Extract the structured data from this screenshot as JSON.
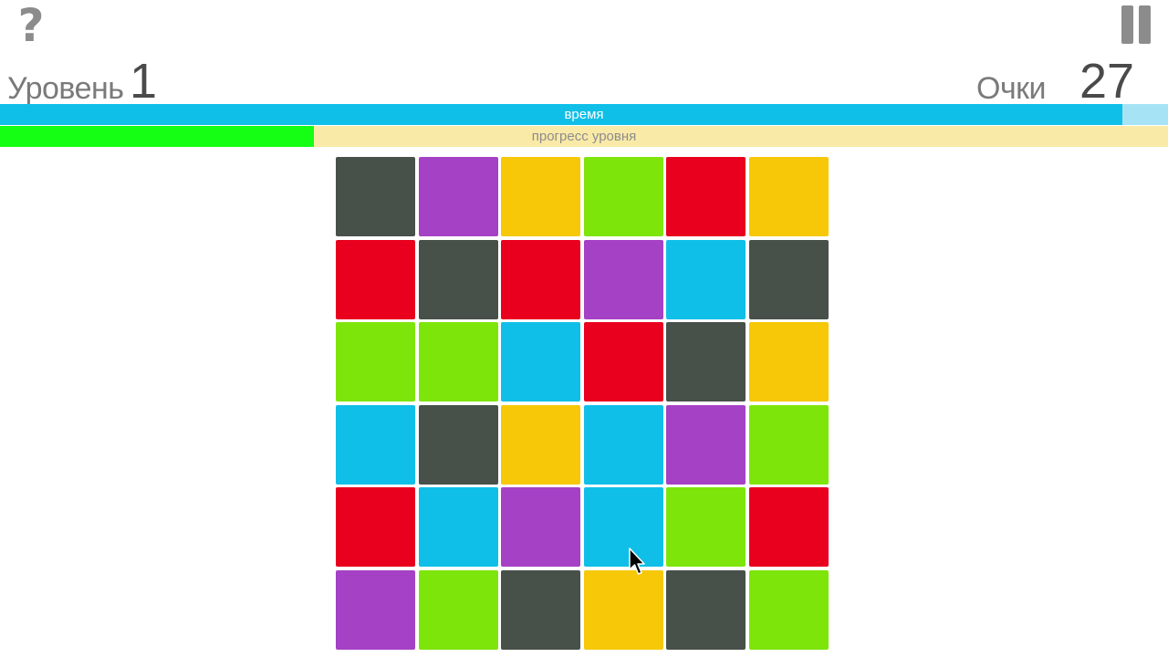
{
  "header": {
    "help_icon": "question-mark-icon",
    "help_glyph": "?",
    "pause_icon": "pause-icon",
    "level_label": "Уровень",
    "level_value": "1",
    "score_label": "Очки",
    "score_value": "27"
  },
  "bars": {
    "time_label": "время",
    "time_fraction": 0.961,
    "time_color": "#10bfe8",
    "time_track_color": "#a6e4f5",
    "progress_label": "прогресс уровня",
    "progress_fraction": 0.269,
    "progress_color": "#14ff14",
    "progress_track_color": "#faeaa8"
  },
  "palette": {
    "gray": "#475049",
    "purple": "#a541c5",
    "yellow": "#f6c808",
    "green": "#7ee50a",
    "red": "#e8001e",
    "blue": "#10bfe8"
  },
  "board": {
    "rows": [
      [
        "gray",
        "purple",
        "yellow",
        "green",
        "red",
        "yellow"
      ],
      [
        "red",
        "gray",
        "red",
        "purple",
        "blue",
        "gray"
      ],
      [
        "green",
        "green",
        "blue",
        "red",
        "gray",
        "yellow"
      ],
      [
        "blue",
        "gray",
        "yellow",
        "blue",
        "purple",
        "green"
      ],
      [
        "red",
        "blue",
        "purple",
        "blue",
        "green",
        "red"
      ],
      [
        "purple",
        "green",
        "gray",
        "yellow",
        "gray",
        "green"
      ]
    ]
  }
}
